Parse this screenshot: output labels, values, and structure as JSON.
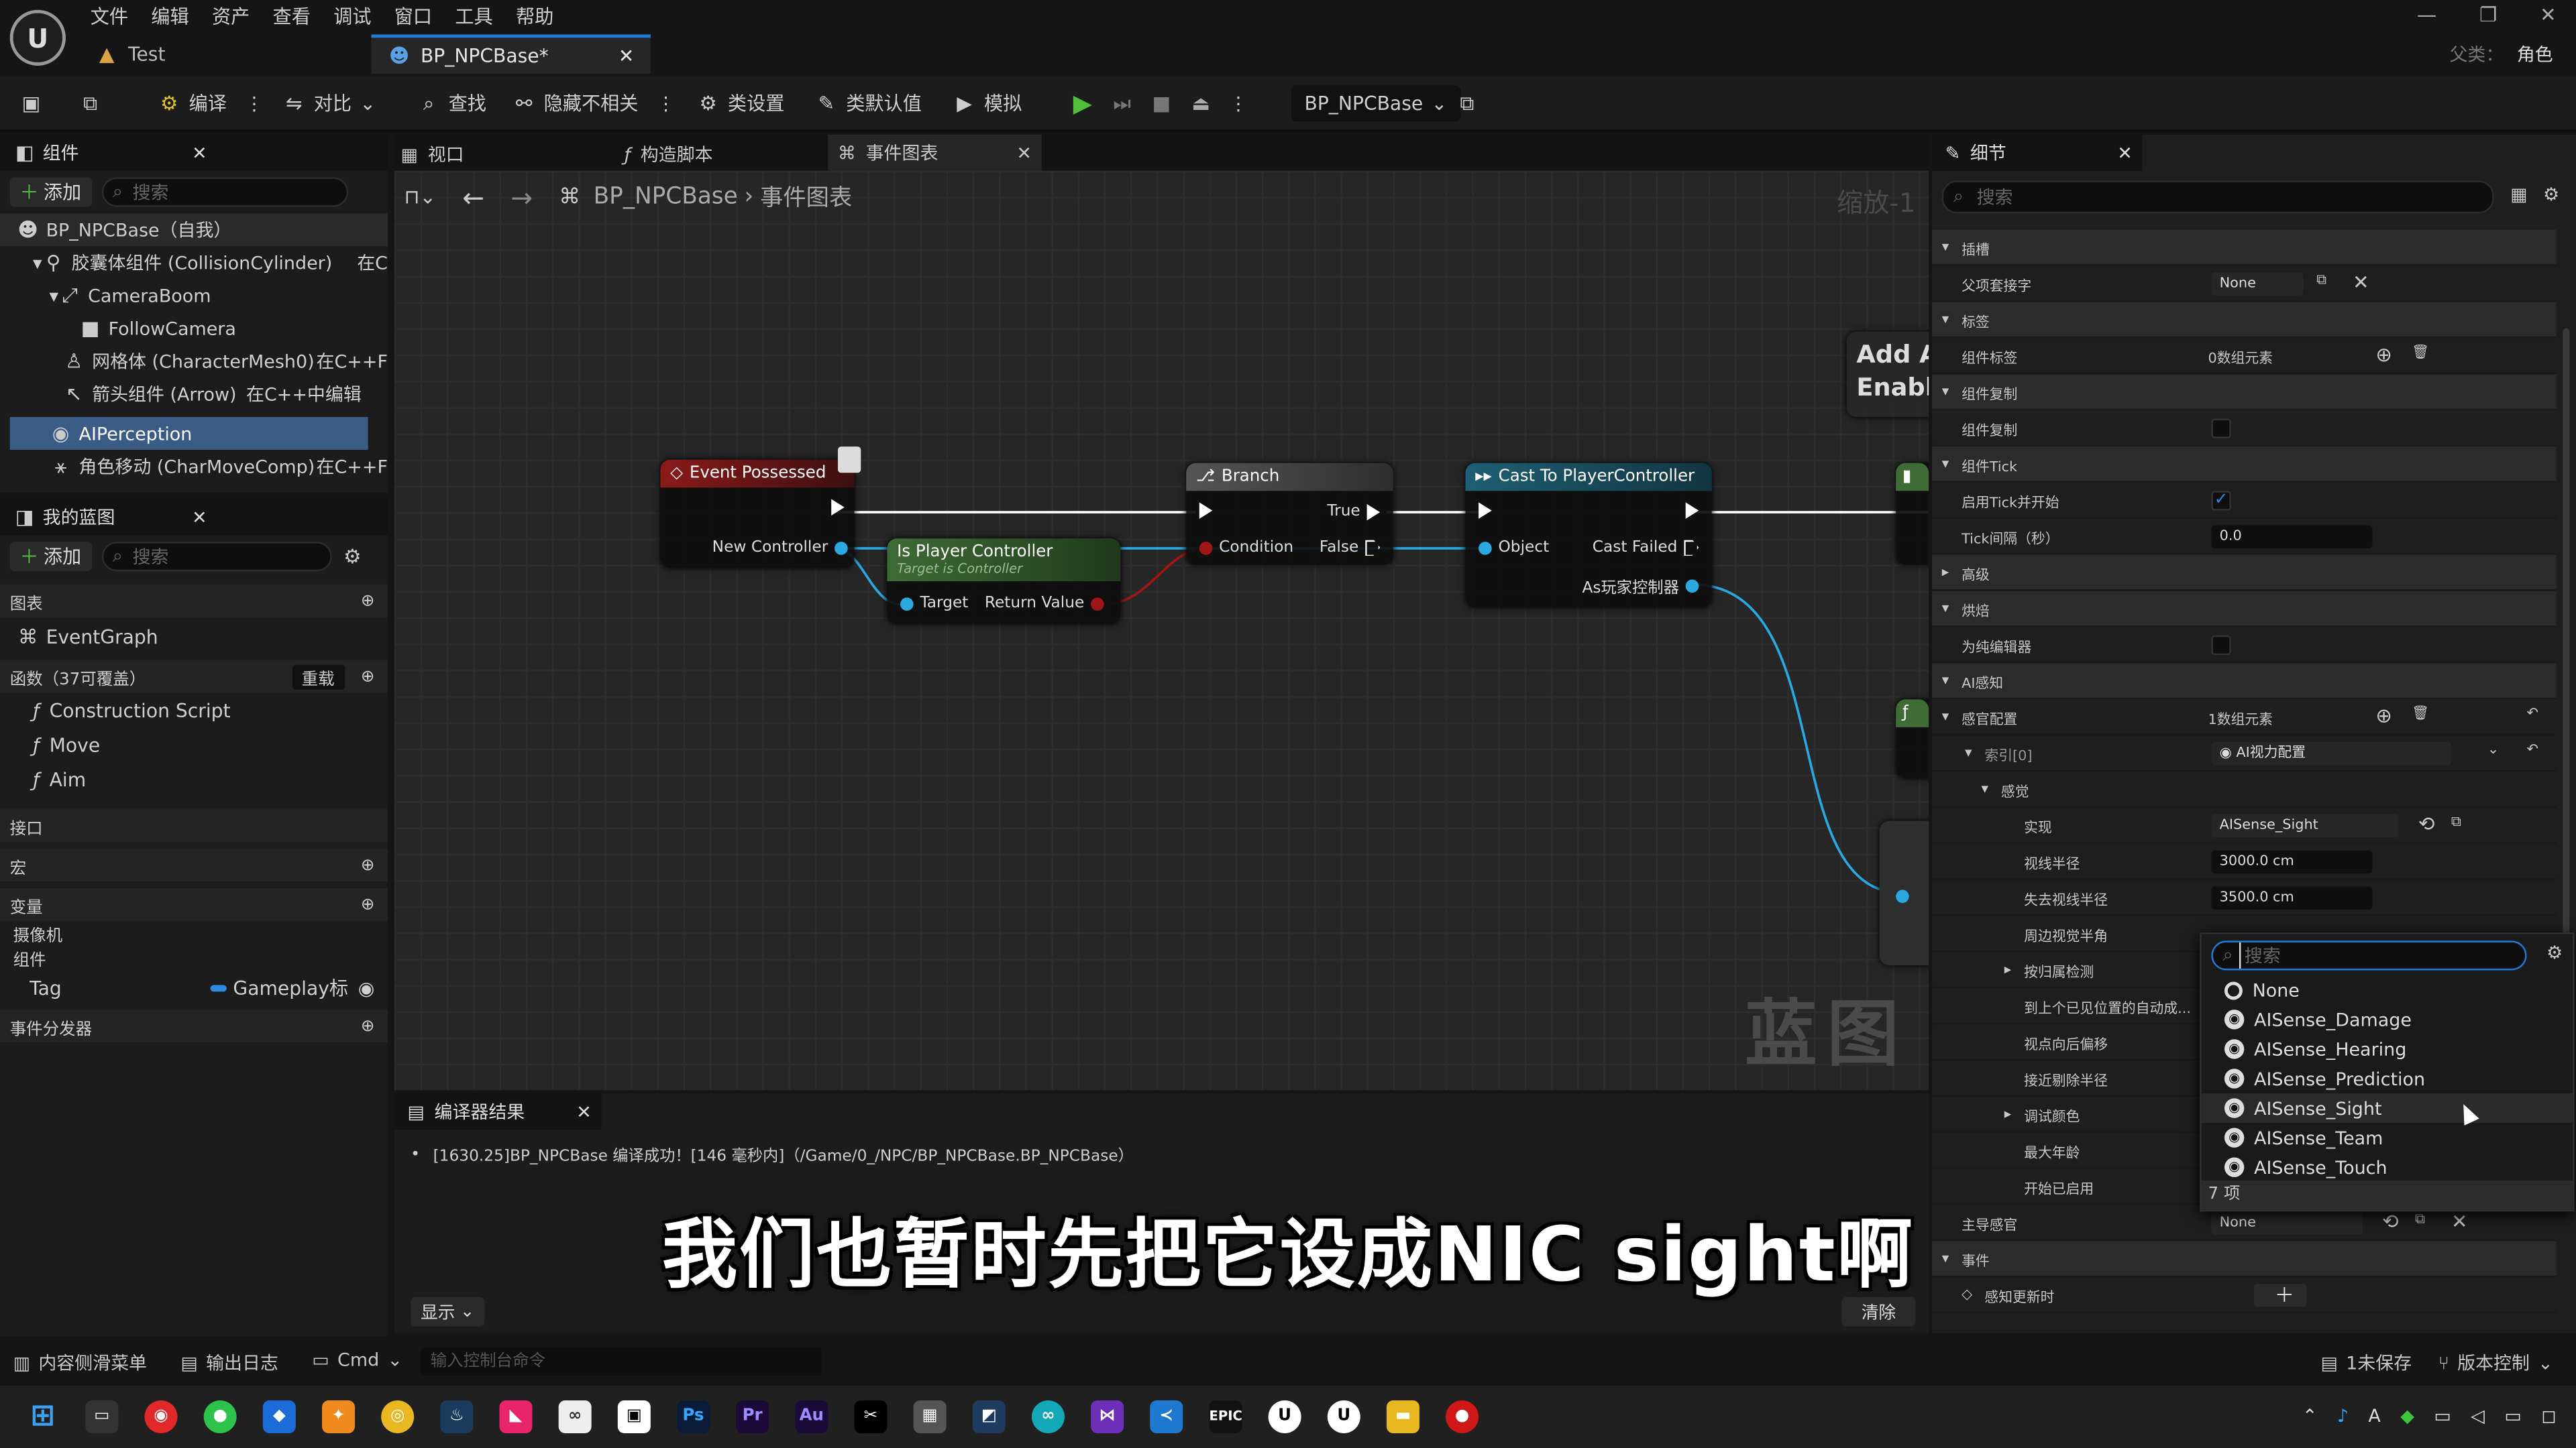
{
  "menu": [
    "文件",
    "编辑",
    "资产",
    "查看",
    "调试",
    "窗口",
    "工具",
    "帮助"
  ],
  "tabs": [
    {
      "label": "Test"
    },
    {
      "label": "BP_NPCBase*"
    }
  ],
  "parent": {
    "label": "父类：",
    "value": "角色"
  },
  "toolbar": {
    "compile": "编译",
    "diff": "对比",
    "find": "查找",
    "hide": "隐藏不相关",
    "class_settings": "类设置",
    "class_defaults": "类默认值",
    "simulate": "模拟",
    "debug_target": "BP_NPCBase"
  },
  "components": {
    "tab": "组件",
    "add": "添加",
    "search_placeholder": "搜索",
    "items": [
      "BP_NPCBase（自我）",
      "胶囊体组件 (CollisionCylinder)",
      "在C",
      "CameraBoom",
      "FollowCamera",
      "网格体 (CharacterMesh0)",
      "在C++F",
      "箭头组件 (Arrow)",
      "在C++中编辑",
      "AIPerception",
      "角色移动 (CharMoveComp)",
      "在C++F"
    ]
  },
  "mybp": {
    "tab": "我的蓝图",
    "add": "添加",
    "search_placeholder": "搜索",
    "graphs": "图表",
    "eventgraph": "EventGraph",
    "functions": "函数（37可覆盖）",
    "override": "重载",
    "func_items": [
      "Construction Script",
      "Move",
      "Aim"
    ],
    "interfaces": "接口",
    "macros": "宏",
    "variables": "变量",
    "var_cats": [
      "摄像机",
      "组件"
    ],
    "tag_var": "Tag",
    "tag_type": "Gameplay标",
    "dispatchers": "事件分发器"
  },
  "graph_tabs": [
    "视口",
    "构造脚本",
    "事件图表"
  ],
  "breadcrumb": {
    "bp": "BP_NPCBase",
    "graph": "事件图表",
    "zoom": "缩放-1"
  },
  "watermark": "蓝图",
  "partial_node": [
    "Add A",
    "Enabl"
  ],
  "nodes": {
    "event_possessed": {
      "title": "Event Possessed",
      "pin": "New Controller"
    },
    "is_player": {
      "title": "Is Player Controller",
      "subtitle": "Target is Controller",
      "target": "Target",
      "ret": "Return Value"
    },
    "branch": {
      "title": "Branch",
      "cond": "Condition",
      "t": "True",
      "f": "False"
    },
    "cast": {
      "title": "Cast To PlayerController",
      "obj": "Object",
      "failed": "Cast Failed",
      "as": "As玩家控制器"
    }
  },
  "compiler": {
    "tab": "编译器结果",
    "message": "[1630.25]BP_NPCBase 编译成功！[146 毫秒内]（/Game/0_/NPC/BP_NPCBase.BP_NPCBase）",
    "show": "显示",
    "clear": "清除"
  },
  "details": {
    "tab": "细节",
    "search_placeholder": "搜索",
    "s_socket": "插槽",
    "parent_socket": "父项套接字",
    "parent_socket_val": "None",
    "s_tags": "标签",
    "comp_tags": "组件标签",
    "comp_tags_val": "0数组元素",
    "s_replication": "组件复制",
    "comp_repl": "组件复制",
    "s_tick": "组件Tick",
    "tick_start": "启用Tick并开始",
    "tick_interval": "Tick间隔（秒）",
    "tick_interval_val": "0.0",
    "s_advanced": "高级",
    "s_cook": "烘焙",
    "editor_only": "为纯编辑器",
    "s_ai": "AI感知",
    "senses_cfg": "感官配置",
    "senses_cfg_val": "1数组元素",
    "index0": "索引[0]",
    "index0_val": "AI视力配置",
    "s_sense": "感觉",
    "impl": "实现",
    "impl_val": "AISense_Sight",
    "sight_radius": "视线半径",
    "sight_radius_val": "3000.0 cm",
    "lose_radius": "失去视线半径",
    "lose_radius_val": "3500.0 cm",
    "periph": "周边视觉半角",
    "detect_aff": "按归属检测",
    "auto_success": "到上个已见位置的自动成...",
    "point_offset": "视点向后偏移",
    "near_clip": "接近剔除半径",
    "debug_color": "调试颜色",
    "max_age": "最大年龄",
    "start_enabled": "开始已启用",
    "dominant": "主导感官",
    "dominant_val": "None",
    "s_events": "事件",
    "on_update": "感知更新时"
  },
  "dropdown": {
    "search_placeholder": "搜索",
    "items": [
      "None",
      "AISense_Damage",
      "AISense_Hearing",
      "AISense_Prediction",
      "AISense_Sight",
      "AISense_Team",
      "AISense_Touch"
    ],
    "count": "7 项"
  },
  "bottom": {
    "content_drawer": "内容侧滑菜单",
    "output_log": "输出日志",
    "cmd": "Cmd",
    "cmd_placeholder": "输入控制台命令",
    "unsaved": "1未保存",
    "source_control": "版本控制"
  },
  "subtitle": "我们也暂时先把它设成NIC sight啊",
  "colors": {
    "accent": "#1f7bd8",
    "event": "#8b1a1a",
    "pure": "#3f6b36",
    "branch": "#4a4a4a",
    "cast": "#1e5f73"
  }
}
